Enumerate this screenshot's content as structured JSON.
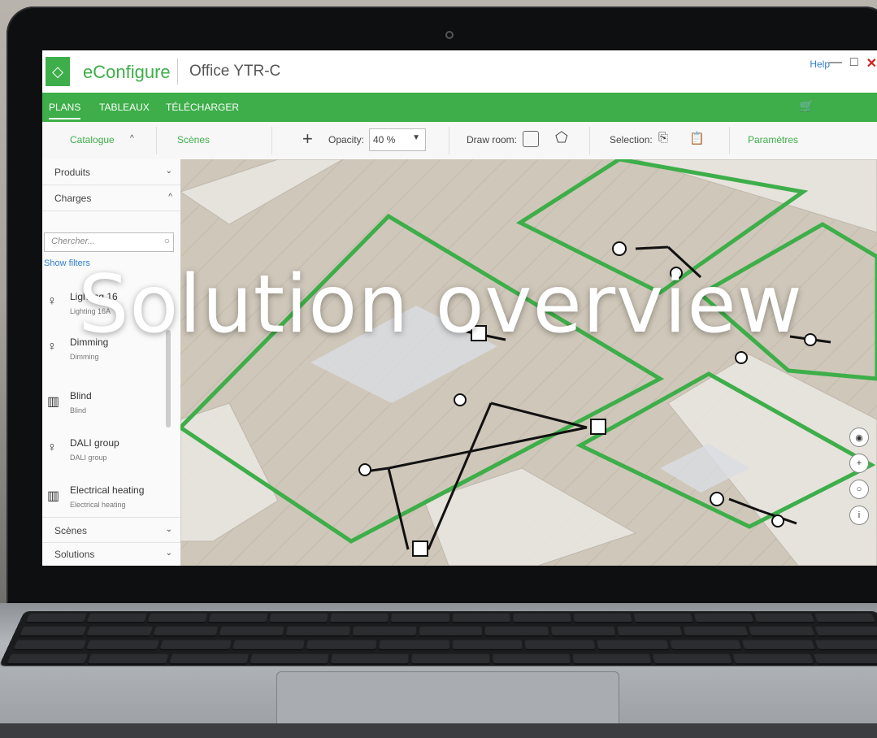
{
  "app": {
    "name": "eConfigure",
    "project": "Office YTR-C",
    "help": "Help",
    "logo_icon": "diamond-icon",
    "window_controls": [
      "—",
      "□",
      "✕"
    ]
  },
  "menu": {
    "items": [
      "PLANS",
      "TABLEAUX",
      "TÉLÉCHARGER"
    ],
    "cart_icon": "cart-icon"
  },
  "toolbar": {
    "catalogue": "Catalogue",
    "scenes": "Scènes",
    "opacity_label": "Opacity:",
    "opacity_value": "40 %",
    "draw_room_label": "Draw room:",
    "selection_label": "Selection:",
    "parametres": "Paramètres"
  },
  "sidebar": {
    "sections": {
      "produits": "Produits",
      "charges": "Charges",
      "scenes": "Scènes",
      "solutions": "Solutions"
    },
    "search_placeholder": "Chercher...",
    "show_filters": "Show filters",
    "items": [
      {
        "name": "Lighting 16",
        "sub": "Lighting 16A",
        "icon": "bulb-icon"
      },
      {
        "name": "Dimming",
        "sub": "Dimming",
        "icon": "dimmer-bulb-icon"
      },
      {
        "name": "Blind",
        "sub": "Blind",
        "icon": "blind-icon"
      },
      {
        "name": "DALI group",
        "sub": "DALI group",
        "icon": "dali-bulb-icon"
      },
      {
        "name": "Electrical heating",
        "sub": "Electrical heating",
        "icon": "heater-icon"
      }
    ]
  },
  "overlay_title": "Solution overview",
  "colors": {
    "brand_green": "#3dae49",
    "room_outline": "#3dae49",
    "link_blue": "#2f7fd1"
  }
}
